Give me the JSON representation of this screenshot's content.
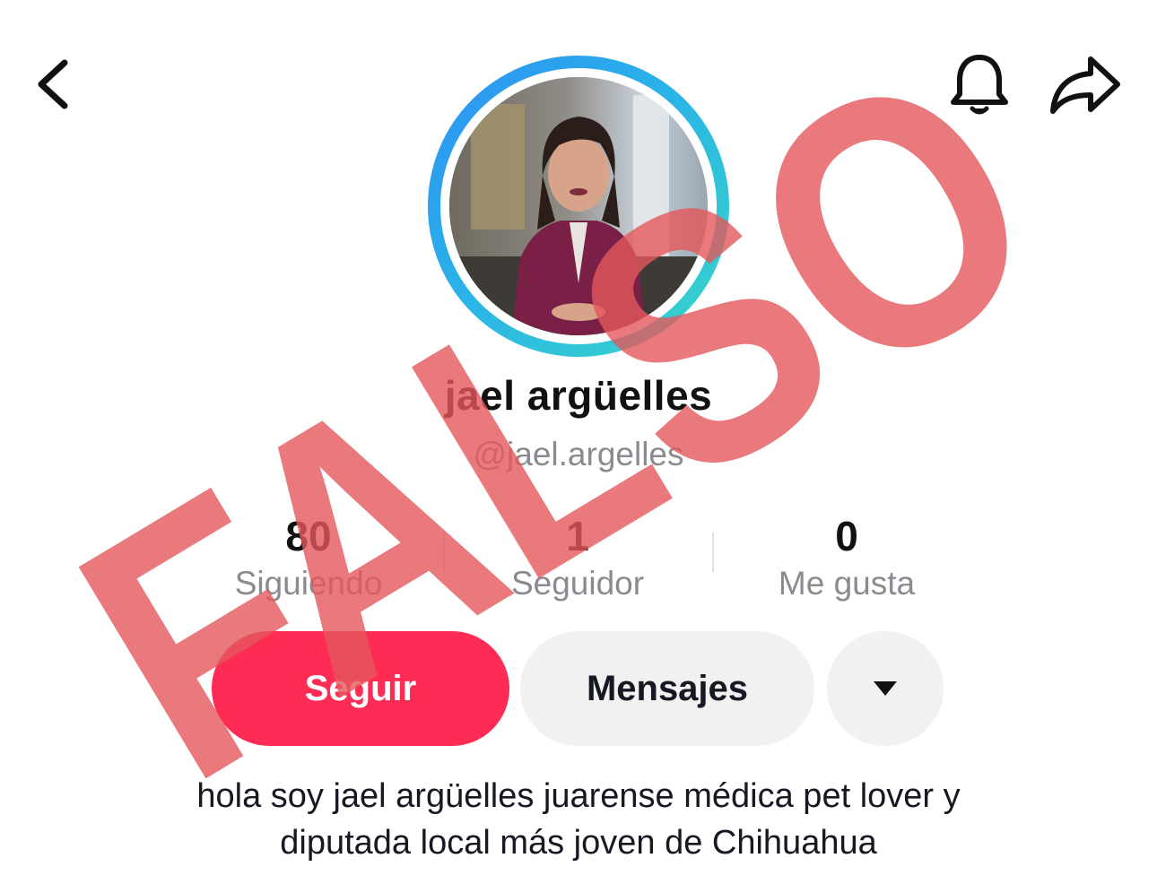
{
  "profile": {
    "display_name": "jael argüelles",
    "username": "@jael.argelles",
    "bio_line1": "hola soy jael argüelles juarense médica pet lover y",
    "bio_line2": "diputada local más joven de Chihuahua"
  },
  "stats": {
    "following": {
      "value": "80",
      "label": "Siguiendo"
    },
    "followers": {
      "value": "1",
      "label": "Seguidor"
    },
    "likes": {
      "value": "0",
      "label": "Me gusta"
    }
  },
  "actions": {
    "follow_label": "Seguir",
    "message_label": "Mensajes"
  },
  "icons": {
    "back": "chevron-left-icon",
    "notifications": "bell-icon",
    "share": "share-arrow-icon",
    "more": "caret-down-icon"
  },
  "overlay": {
    "stamp_text": "FALSO",
    "stamp_color": "#e4585b"
  },
  "colors": {
    "follow_button": "#fe2c55",
    "secondary_button": "#f1f1f2",
    "avatar_ring_start": "#2f8ff5",
    "avatar_ring_end": "#3ad6c8"
  }
}
